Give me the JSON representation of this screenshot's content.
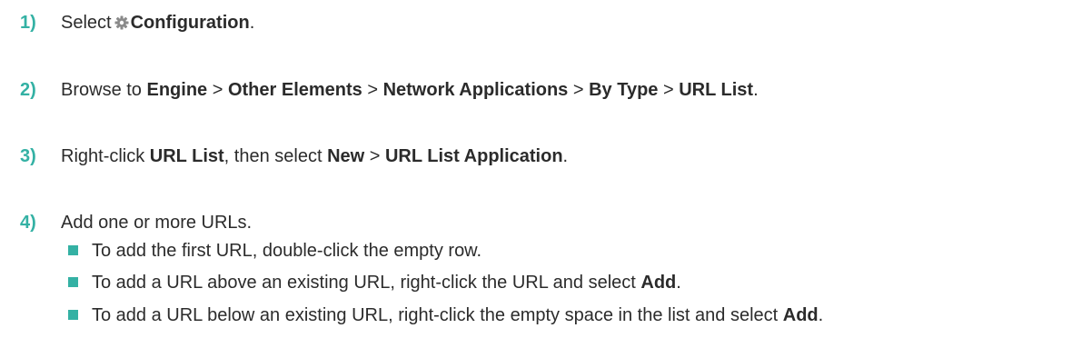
{
  "steps": [
    {
      "number": "1)",
      "parts": [
        "Select",
        "Configuration",
        "."
      ],
      "icon": "gear-icon"
    },
    {
      "number": "2)",
      "parts": [
        "Browse to ",
        "Engine",
        " > ",
        "Other Elements",
        " > ",
        "Network Applications",
        " > ",
        "By Type",
        " > ",
        "URL List",
        "."
      ]
    },
    {
      "number": "3)",
      "parts": [
        "Right-click ",
        "URL List",
        ", then select ",
        "New",
        " > ",
        "URL List Application",
        "."
      ]
    },
    {
      "number": "4)",
      "parts": [
        "Add one or more URLs."
      ],
      "bullets": [
        {
          "parts": [
            "To add the first URL, double-click the empty row."
          ]
        },
        {
          "parts": [
            "To add a URL above an existing URL, right-click the URL and select ",
            "Add",
            "."
          ]
        },
        {
          "parts": [
            "To add a URL below an existing URL, right-click the empty space in the list and select ",
            "Add",
            "."
          ]
        }
      ]
    }
  ],
  "colors": {
    "accent": "#34b1a4",
    "text": "#2b2b2b",
    "icon": "#8a8a8a"
  }
}
